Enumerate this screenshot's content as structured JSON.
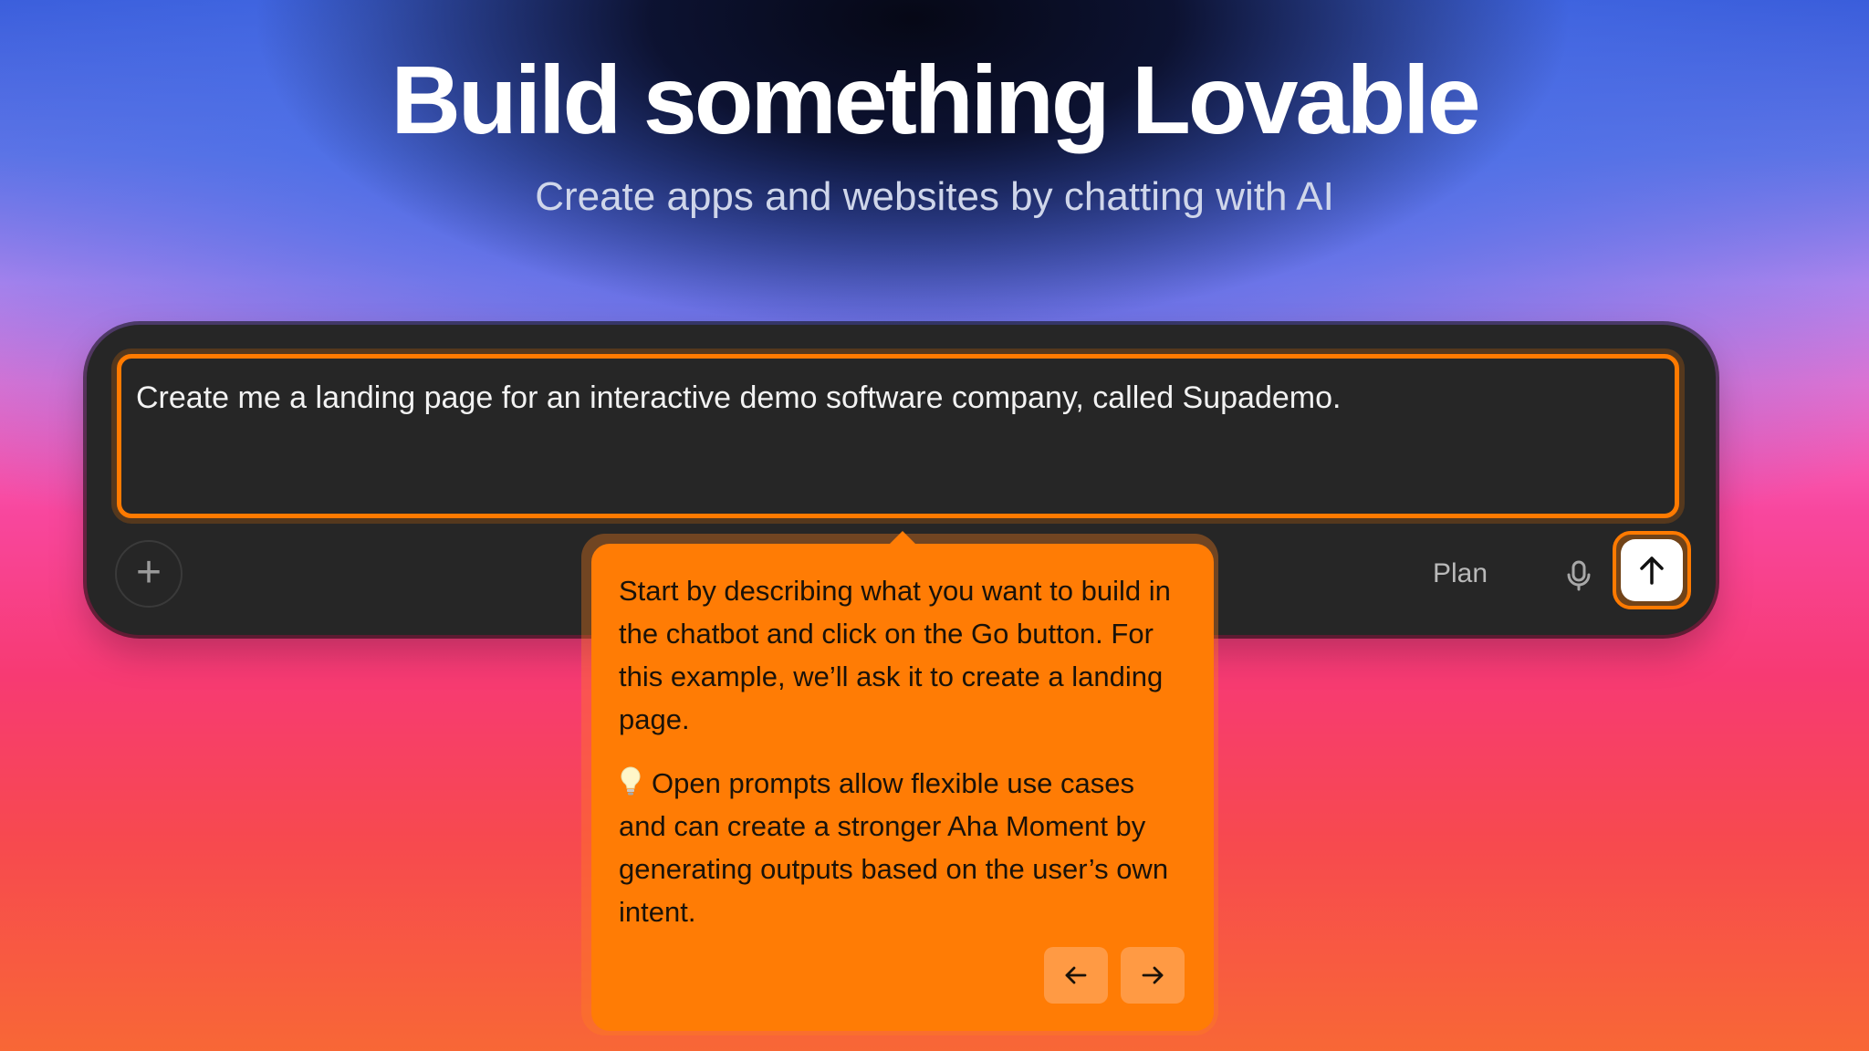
{
  "hero": {
    "title": "Build something Lovable",
    "subtitle": "Create apps and websites by chatting with AI"
  },
  "composer": {
    "prompt_text": "Create me a landing page for an interactive demo software company, called Supademo.",
    "add_symbol": "+",
    "plan_label": "Plan",
    "mic_icon": "microphone-icon",
    "send_icon": "arrow-up-icon"
  },
  "tooltip": {
    "paragraph_1": "Start by describing what you want to build in the chatbot and click on the Go button. For this example, we’ll ask it to create a landing page.",
    "paragraph_2": "Open prompts allow flexible use cases and can create a stronger Aha Moment by generating outputs based on the user’s own intent.",
    "bulb_icon": "lightbulb-icon",
    "prev_icon": "arrow-left-icon",
    "next_icon": "arrow-right-icon"
  },
  "colors": {
    "accent": "#ff7c05",
    "card": "#262626",
    "title": "#ffffff",
    "subtitle": "#cfd6ea"
  }
}
